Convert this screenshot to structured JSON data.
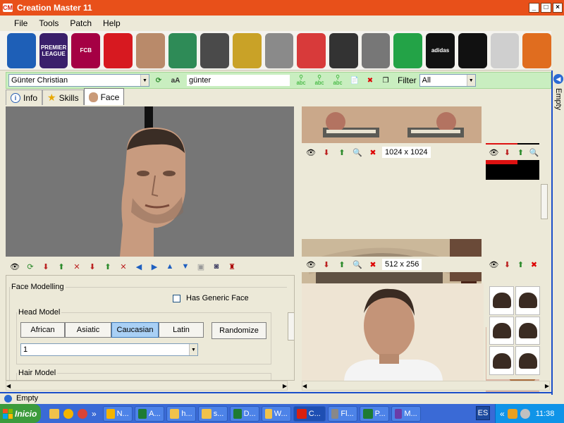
{
  "window": {
    "title": "Creation Master 11",
    "app_icon_text": "CM",
    "minimize": "_",
    "maximize": "□",
    "close": "×"
  },
  "menu": [
    "File",
    "Tools",
    "Patch",
    "Help"
  ],
  "toolbar_icons": [
    {
      "name": "globe-icon",
      "text": "",
      "color": "#1e5fb7"
    },
    {
      "name": "premier-league-icon",
      "text": "PREMIER LEAGUE",
      "color": "#3a1f6b"
    },
    {
      "name": "fcb-crest-icon",
      "text": "FCB",
      "color": "#a50044"
    },
    {
      "name": "jersey-icon",
      "text": "",
      "color": "#d71920"
    },
    {
      "name": "player-icon",
      "text": "",
      "color": "#b98a6a"
    },
    {
      "name": "stadium-icon",
      "text": "",
      "color": "#2e8b57"
    },
    {
      "name": "manager-icon",
      "text": "",
      "color": "#4a4a4a"
    },
    {
      "name": "trophy-icon",
      "text": "",
      "color": "#c9a227"
    },
    {
      "name": "gamepad-icon",
      "text": "",
      "color": "#8a8a8a"
    },
    {
      "name": "cards-icon",
      "text": "",
      "color": "#d83a3a"
    },
    {
      "name": "ball-icon",
      "text": "",
      "color": "#333333"
    },
    {
      "name": "boot-icon",
      "text": "",
      "color": "#777777"
    },
    {
      "name": "pitch-icon",
      "text": "",
      "color": "#23a347"
    },
    {
      "name": "adidas-icon",
      "text": "adidas",
      "color": "#111111"
    },
    {
      "name": "nike-icon",
      "text": "",
      "color": "#111111"
    },
    {
      "name": "newspaper-icon",
      "text": "",
      "color": "#cfcfcf"
    },
    {
      "name": "glove-icon",
      "text": "",
      "color": "#e06d1f"
    }
  ],
  "search": {
    "player": "Günter Christian",
    "text": "günter",
    "filter_label": "Filter",
    "filter_value": "All",
    "font_toggle": "aA",
    "abc": [
      "abc",
      "abc",
      "abc"
    ]
  },
  "tabs": [
    "Info",
    "Skills",
    "Face"
  ],
  "right_strip": "Empty",
  "textures": {
    "size1": "1024 x 1024",
    "size2": "512 x 256"
  },
  "face_panel": {
    "section": "Face Modelling",
    "generic_face": "Has Generic Face",
    "head_model": "Head Model",
    "head_options": [
      "African",
      "Asiatic",
      "Caucasian",
      "Latin"
    ],
    "head_selected": "Caucasian",
    "randomize": "Randomize",
    "head_number": "1",
    "hair_model": "Hair Model"
  },
  "status_text": "Empty",
  "taskbar": {
    "start": "Inicio",
    "tasks": [
      {
        "label": "N...",
        "color": "#f4b400"
      },
      {
        "label": "A...",
        "color": "#1e7b34"
      },
      {
        "label": "h...",
        "color": "#f0c24a"
      },
      {
        "label": "s...",
        "color": "#f0c24a"
      },
      {
        "label": "D...",
        "color": "#1e7b34"
      },
      {
        "label": "W...",
        "color": "#f0c24a"
      },
      {
        "label": "C...",
        "color": "#d9200f"
      },
      {
        "label": "Fl...",
        "color": "#888888"
      },
      {
        "label": "P...",
        "color": "#1e7b34"
      },
      {
        "label": "M...",
        "color": "#6a3da8"
      }
    ],
    "lang": "ES",
    "chevron": "«",
    "quick_chevron": "»",
    "time": "11:38"
  }
}
